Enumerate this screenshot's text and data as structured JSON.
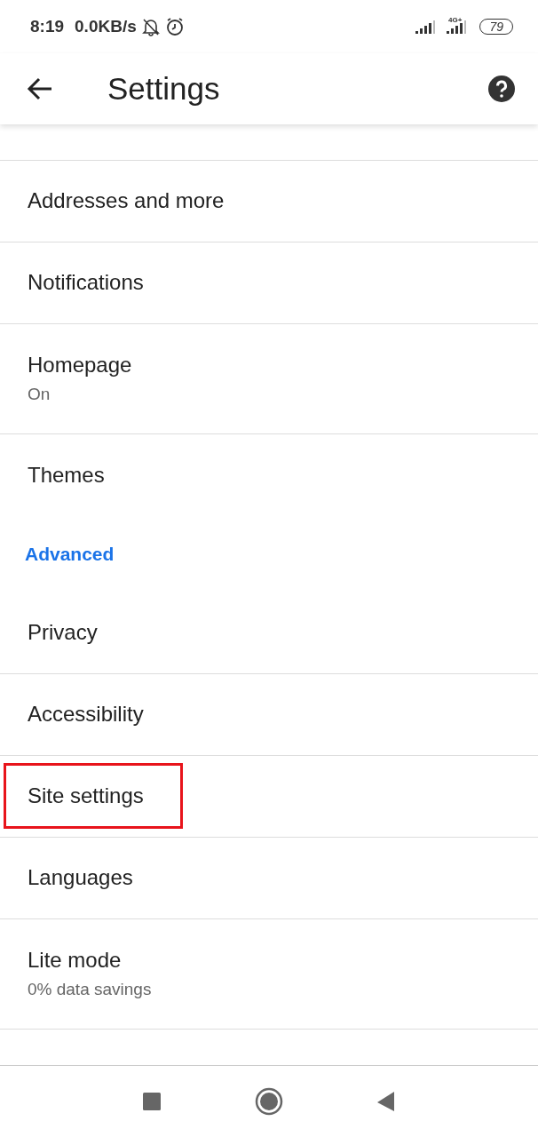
{
  "status_bar": {
    "time": "8:19",
    "speed": "0.0KB/s",
    "network": "4G+",
    "battery": "79"
  },
  "app_bar": {
    "title": "Settings"
  },
  "items": [
    {
      "kind": "item",
      "title": "Addresses and more"
    },
    {
      "kind": "item",
      "title": "Notifications"
    },
    {
      "kind": "item",
      "title": "Homepage",
      "subtitle": "On"
    },
    {
      "kind": "item",
      "title": "Themes"
    },
    {
      "kind": "section",
      "title": "Advanced"
    },
    {
      "kind": "item",
      "title": "Privacy"
    },
    {
      "kind": "item",
      "title": "Accessibility"
    },
    {
      "kind": "item",
      "title": "Site settings",
      "highlighted": true
    },
    {
      "kind": "item",
      "title": "Languages"
    },
    {
      "kind": "item",
      "title": "Lite mode",
      "subtitle": "0% data savings"
    }
  ]
}
